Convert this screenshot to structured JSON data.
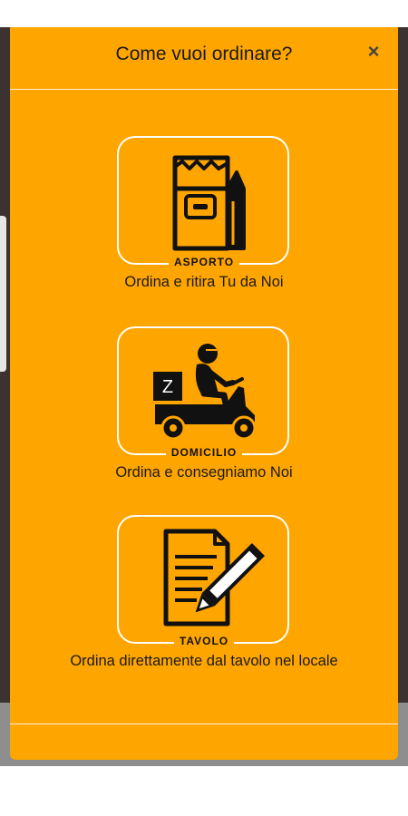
{
  "modal": {
    "title": "Come vuoi ordinare?",
    "close_symbol": "×"
  },
  "options": [
    {
      "tag": "ASPORTO",
      "description": "Ordina e ritira Tu da Noi",
      "icon": "takeaway-bag-icon"
    },
    {
      "tag": "DOMICILIO",
      "description": "Ordina e consegniamo Noi",
      "icon": "delivery-scooter-icon",
      "box_letter": "Z"
    },
    {
      "tag": "TAVOLO",
      "description": "Ordina direttamente dal tavolo nel locale",
      "icon": "table-order-icon"
    }
  ],
  "colors": {
    "modal_background": "#ffa500",
    "backdrop": "#3c3330",
    "text": "#1a1a1a"
  }
}
